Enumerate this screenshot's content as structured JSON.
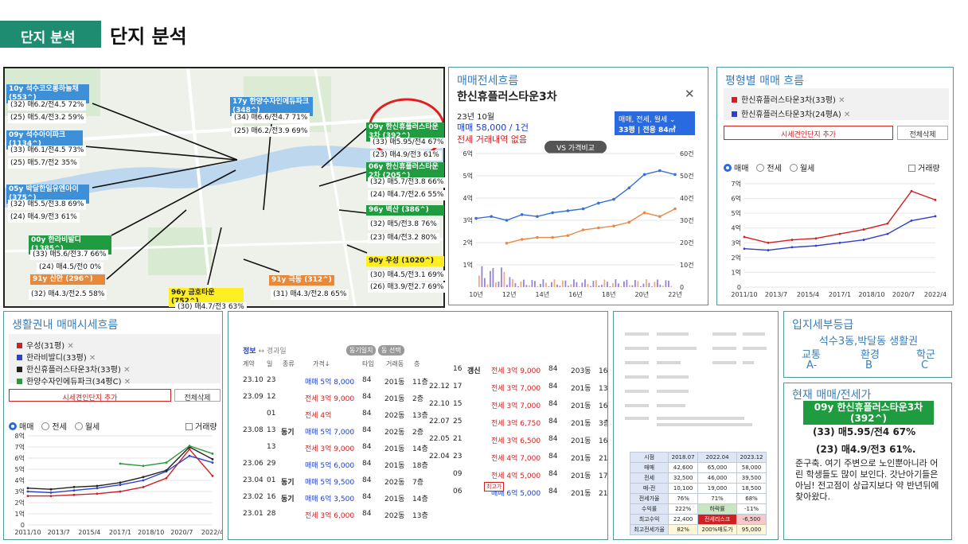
{
  "header": {
    "tag": "단지 분석",
    "title": "단지 분석"
  },
  "map": {
    "labels": [
      {
        "text": "10y 석수코오롱하늘채 (553^)",
        "color": "blue",
        "l": 6,
        "t": 104,
        "w": 104
      },
      {
        "text": "09y 석수아이파크 (1134^)",
        "color": "blue",
        "l": 6,
        "t": 162,
        "w": 96
      },
      {
        "text": "05y 박달한일유엔아이 (375^)",
        "color": "blue",
        "l": 6,
        "t": 230,
        "w": 104
      },
      {
        "text": "00y 한라비발디 (1385^)",
        "color": "green",
        "l": 34,
        "t": 294,
        "w": 104
      },
      {
        "text": "91y 신안 (296^)",
        "color": "orange",
        "l": 36,
        "t": 343,
        "w": 94
      },
      {
        "text": "17y 한양수자인에듀파크 (348^)",
        "color": "blue",
        "l": 287,
        "t": 120,
        "w": 104
      },
      {
        "text": "09y 한신휴플러스타운3차 (392^)",
        "color": "green",
        "l": 458,
        "t": 152,
        "w": 98
      },
      {
        "text": "06y 한신휴플러스타운2차 (205^)",
        "color": "green",
        "l": 458,
        "t": 202,
        "w": 98
      },
      {
        "text": "96y 벽산 (386^)",
        "color": "green",
        "l": 458,
        "t": 256,
        "w": 98
      },
      {
        "text": "90y 우성 (1020^)",
        "color": "yellow",
        "l": 458,
        "t": 320,
        "w": 98
      },
      {
        "text": "91y 극동 (312^)",
        "color": "orange",
        "l": 336,
        "t": 344,
        "w": 82
      },
      {
        "text": "96y 금호타운 (752^)",
        "color": "yellow",
        "l": 210,
        "t": 360,
        "w": 94
      }
    ],
    "texts": [
      {
        "text": "(32) 매6.2/전4.5 72%",
        "l": 8,
        "t": 124
      },
      {
        "text": "(25) 매5.4/전3.2 59%",
        "l": 8,
        "t": 140
      },
      {
        "text": "(33) 매6.1/전4.5 73%",
        "l": 8,
        "t": 181
      },
      {
        "text": "(25) 매5.7/전2 35%",
        "l": 8,
        "t": 197
      },
      {
        "text": "(32) 매5.5/전3.8 69%",
        "l": 8,
        "t": 249
      },
      {
        "text": "(24) 매4.9/전3 61%",
        "l": 8,
        "t": 265
      },
      {
        "text": "(33) 매5.6/전3.7 66%",
        "l": 36,
        "t": 312
      },
      {
        "text": "(24) 매4.5/전0 0%",
        "l": 44,
        "t": 328
      },
      {
        "text": "(32) 매4.3/전2.5 58%",
        "l": 34,
        "t": 362
      },
      {
        "text": "(34) 매6.6/전4.7 71%",
        "l": 289,
        "t": 140
      },
      {
        "text": "(25) 매6.2/전3.9 69%",
        "l": 289,
        "t": 157
      },
      {
        "text": "(33) 매5.95/전4 67%",
        "l": 463,
        "t": 171
      },
      {
        "text": "(23) 매4.9/전3 61%",
        "l": 463,
        "t": 187
      },
      {
        "text": "(32) 매5.7/전3.8 66%",
        "l": 460,
        "t": 221
      },
      {
        "text": "(24) 매4.7/전2.6 55%",
        "l": 460,
        "t": 237
      },
      {
        "text": "(32) 매5/전3.8 76%",
        "l": 460,
        "t": 274
      },
      {
        "text": "(23) 매4/전3.2 80%",
        "l": 460,
        "t": 291
      },
      {
        "text": "(30) 매4.5/전3.1 69%",
        "l": 460,
        "t": 338
      },
      {
        "text": "(26) 매3.9/전2.7 69%",
        "l": 460,
        "t": 353
      },
      {
        "text": "(31) 매4.3/전2.8 65%",
        "l": 338,
        "t": 362
      },
      {
        "text": "(30) 매4.7/전3 63%",
        "l": 218,
        "t": 378
      }
    ]
  },
  "flow": {
    "title": "매매전세흐름",
    "complex": "한신휴플러스타운3차",
    "close": "✕",
    "month": "23년 10월",
    "trade": "매매 58,000 / 1건",
    "jeonse": "전세 거래내역 없음",
    "filter_line1": "매매, 전세, 월세 ⌄",
    "filter_line2": "33평 | 전용 84㎡",
    "vs_button": "VS 가격비교",
    "chart_data": {
      "type": "line",
      "x": [
        "10년",
        "12년",
        "14년",
        "16년",
        "18년",
        "20년",
        "22년"
      ],
      "y_left": [
        "1억",
        "2억",
        "3억",
        "4억",
        "5억",
        "6억"
      ],
      "y_right": [
        "0",
        "10건",
        "20건",
        "30건",
        "40건",
        "50건",
        "60건"
      ],
      "series": [
        {
          "name": "매매",
          "color": "#3a6fd8",
          "values": [
            3.6,
            3.7,
            3.5,
            3.8,
            3.7,
            3.9,
            4.0,
            4.1,
            4.4,
            4.6,
            5.2,
            5.9,
            6.1,
            5.9
          ]
        },
        {
          "name": "전세",
          "color": "#e8884a",
          "values": [
            null,
            null,
            2.3,
            2.5,
            2.6,
            2.6,
            2.7,
            3.0,
            3.1,
            3.2,
            3.4,
            3.9,
            3.7,
            4.1
          ]
        }
      ]
    }
  },
  "pyeong": {
    "title": "평형별 매매 흐름",
    "items": [
      {
        "name": "한신휴플러스타운3차(33평)",
        "color": "#d02020"
      },
      {
        "name": "한신휴플러스타운3차(24평A)",
        "color": "#3040c8"
      }
    ],
    "add_btn": "시세견인단지 추가",
    "del_btn": "전체삭제",
    "radios": [
      "매매",
      "전세",
      "월세"
    ],
    "volume": "거래량",
    "chart_data": {
      "type": "line",
      "x": [
        "2011/10",
        "2013/7",
        "2015/4",
        "2017/1",
        "2018/10",
        "2020/7",
        "2022/4"
      ],
      "y": [
        "0",
        "1억",
        "2억",
        "3억",
        "4억",
        "5억",
        "6억",
        "7억"
      ],
      "series": [
        {
          "name": "한신휴플러스타운3차(33평)",
          "color": "#d02020",
          "values": [
            3.4,
            3.0,
            3.2,
            3.3,
            3.6,
            3.9,
            4.3,
            6.5,
            5.9
          ]
        },
        {
          "name": "한신휴플러스타운3차(24평A)",
          "color": "#3040c8",
          "values": [
            2.6,
            2.5,
            2.7,
            2.8,
            3.0,
            3.2,
            3.6,
            4.5,
            4.8
          ]
        }
      ]
    }
  },
  "life": {
    "title": "생활권내 매매시세흐름",
    "items": [
      {
        "name": "우성(31평)",
        "color": "#d02020"
      },
      {
        "name": "한라비발디(33평)",
        "color": "#3040c8"
      },
      {
        "name": "한신휴플러스타운3차(33평)",
        "color": "#222222"
      },
      {
        "name": "한양수자인에듀파크(34평C)",
        "color": "#2a9a3a"
      }
    ],
    "add_btn": "시세견인단지 추가",
    "del_btn": "전체삭제",
    "radios": [
      "매매",
      "전세",
      "월세"
    ],
    "volume": "거래량",
    "chart_data": {
      "type": "line",
      "x": [
        "2011/10",
        "2013/7",
        "2015/4",
        "2017/1",
        "2018/10",
        "2020/7",
        "2022/4"
      ],
      "y": [
        "0",
        "1억",
        "2억",
        "3억",
        "4억",
        "5억",
        "6억",
        "7억",
        "8억"
      ],
      "series": [
        {
          "name": "우성(31평)",
          "color": "#d02020",
          "values": [
            2.6,
            2.6,
            2.7,
            2.8,
            3.0,
            3.4,
            4.2,
            6.8,
            4.4
          ]
        },
        {
          "name": "한라비발디(33평)",
          "color": "#3040c8",
          "values": [
            3.0,
            2.9,
            3.1,
            3.3,
            3.6,
            4.0,
            4.8,
            6.2,
            5.6
          ]
        },
        {
          "name": "한신휴플러스타운3차(33평)",
          "color": "#222222",
          "values": [
            3.3,
            3.2,
            3.4,
            3.5,
            3.8,
            4.3,
            4.9,
            7.0,
            5.9
          ]
        },
        {
          "name": "한양수자인에듀파크(34평C)",
          "color": "#2a9a3a",
          "values": [
            null,
            null,
            null,
            null,
            5.5,
            5.3,
            5.6,
            7.1,
            6.4
          ]
        }
      ]
    }
  },
  "deals": {
    "tab1": "정보",
    "tab_sep": "↔",
    "tab2": "경과일",
    "pill1": "동기일치",
    "pill2": "동 선택",
    "headers": [
      "계약",
      "일",
      "종류",
      "가격↓",
      "타입",
      "거래동",
      "층"
    ],
    "rows": [
      {
        "ym": "23.10",
        "d": "23",
        "k": "",
        "p": "매매 5억 8,000",
        "pc": "blue",
        "t": "84",
        "dong": "201동",
        "f": "11층"
      },
      {
        "ym": "23.09",
        "d": "12",
        "k": "",
        "p": "전세 3억 9,000",
        "pc": "red",
        "t": "84",
        "dong": "201동",
        "f": "2층"
      },
      {
        "ym": "",
        "d": "01",
        "k": "",
        "p": "전세 4억",
        "pc": "red",
        "t": "84",
        "dong": "202동",
        "f": "13층"
      },
      {
        "ym": "23.08",
        "d": "13",
        "k": "동기",
        "p": "매매 5억 7,000",
        "pc": "blue",
        "t": "84",
        "dong": "202동",
        "f": "2층"
      },
      {
        "ym": "",
        "d": "13",
        "k": "",
        "p": "전세 3억 9,000",
        "pc": "red",
        "t": "84",
        "dong": "201동",
        "f": "14층"
      },
      {
        "ym": "23.06",
        "d": "29",
        "k": "",
        "p": "매매 5억 6,000",
        "pc": "blue",
        "t": "84",
        "dong": "201동",
        "f": "18층"
      },
      {
        "ym": "23.04",
        "d": "01",
        "k": "동기",
        "p": "매매 5억 9,500",
        "pc": "blue",
        "t": "84",
        "dong": "202동",
        "f": "7층"
      },
      {
        "ym": "23.02",
        "d": "16",
        "k": "동기",
        "p": "매매 6억 3,500",
        "pc": "blue",
        "t": "84",
        "dong": "201동",
        "f": "14층"
      },
      {
        "ym": "23.01",
        "d": "28",
        "k": "",
        "p": "전세 3억 6,000",
        "pc": "red",
        "t": "84",
        "dong": "202동",
        "f": "13층"
      }
    ],
    "rows2": [
      {
        "ym": "",
        "d": "16",
        "k": "갱신",
        "p": "전세 3억 9,000",
        "pc": "red",
        "t": "84",
        "dong": "203동",
        "f": "16층"
      },
      {
        "ym": "22.12",
        "d": "17",
        "k": "",
        "p": "전세 3억 7,000",
        "pc": "red",
        "t": "84",
        "dong": "201동",
        "f": "13층"
      },
      {
        "ym": "22.10",
        "d": "15",
        "k": "",
        "p": "전세 3억 7,000",
        "pc": "red",
        "t": "84",
        "dong": "201동",
        "f": "16층"
      },
      {
        "ym": "22.07",
        "d": "25",
        "k": "",
        "p": "전세 3억 6,750",
        "pc": "red",
        "t": "84",
        "dong": "201동",
        "f": "3층"
      },
      {
        "ym": "22.05",
        "d": "21",
        "k": "",
        "p": "전세 3억 6,500",
        "pc": "red",
        "t": "84",
        "dong": "201동",
        "f": "16층"
      },
      {
        "ym": "22.04",
        "d": "23",
        "k": "",
        "p": "전세 4억 7,000",
        "pc": "red",
        "t": "84",
        "dong": "201동",
        "f": "21층"
      },
      {
        "ym": "",
        "d": "09",
        "k": "",
        "p": "전세 4억 5,000",
        "pc": "red",
        "t": "84",
        "dong": "201동",
        "f": "17층"
      },
      {
        "ym": "",
        "d": "06",
        "k": "",
        "p": "매매 6억 5,000",
        "pc": "blue",
        "t": "84",
        "dong": "201동",
        "f": "21층"
      }
    ],
    "max_badge": "최고가"
  },
  "stats": {
    "headers": [
      "시점",
      "2018.07",
      "2022.04",
      "2023.12"
    ],
    "rows": [
      [
        "매매",
        "42,600",
        "65,000",
        "58,000"
      ],
      [
        "전세",
        "32,500",
        "46,000",
        "39,500"
      ],
      [
        "매-전",
        "10,100",
        "19,000",
        "18,500"
      ],
      [
        "전세가율",
        "76%",
        "71%",
        "68%"
      ],
      [
        "수익률",
        "222%",
        "하락률",
        "-11%"
      ],
      [
        "최고수익",
        "22,400",
        "전세리스크",
        "-6,500"
      ],
      [
        "최고전세가율",
        "82%",
        "200%매도가",
        "95,000"
      ]
    ]
  },
  "location": {
    "title": "입지세부등급",
    "subtitle": "석수3동,박달동 생활권",
    "cats": [
      "교통",
      "환경",
      "학군"
    ],
    "grades": [
      "A-",
      "B",
      "C"
    ]
  },
  "current": {
    "title": "현재 매매/전세가",
    "badge": "09y 한신휴플러스타운3차 (392^)",
    "line1": "(33) 매5.95/전4 67%",
    "line2": "(23) 매4.9/전3 61%.",
    "memo": "준구축. 여기 주변으로 노인뿐아니라 어린 학생들도 많이 보인다. 갓난아기들은 아님! 전고점이 상급지보다 약 반년뒤에 찾아왔다."
  }
}
